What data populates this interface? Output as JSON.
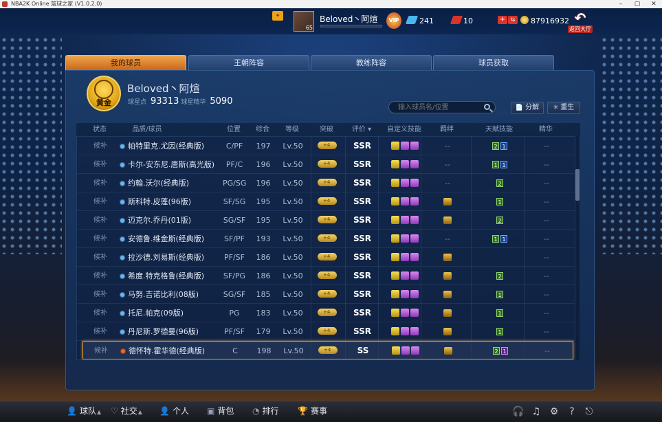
{
  "window": {
    "title": "NBA2K Online 篮球之家 (V1.0.2.0)"
  },
  "topbar": {
    "gift_icon": "gift-box-icon",
    "avatar_level": "65",
    "username": "Beloved丶阿煊",
    "vip_label": "VIP",
    "blue_gems": "241",
    "red_gems": "10",
    "plus_label": "+",
    "exchange_label": "⇆",
    "coins": "87916932",
    "back_label": "返回大厅",
    "back_arrow": "↶"
  },
  "tabs": [
    {
      "label": "我的球员",
      "active": true
    },
    {
      "label": "王朝阵容",
      "active": false
    },
    {
      "label": "教练阵容",
      "active": false
    },
    {
      "label": "球员获取",
      "active": false
    }
  ],
  "profile": {
    "name": "Beloved丶阿煊",
    "tier": "黄金",
    "star_points_label": "球星点",
    "star_points": "93313",
    "essence_label": "球星精华",
    "essence": "5090"
  },
  "search": {
    "placeholder": "输入球员名/位置"
  },
  "tools": {
    "decompose": "分解",
    "decompose_icon": "📄",
    "rebirth": "重生",
    "rebirth_icon": "✳"
  },
  "table": {
    "headers": [
      "状态",
      "品质/球员",
      "位置",
      "综合",
      "等级",
      "突破",
      "评价 ▾",
      "自定义技能",
      "羁绊",
      "天赋技能",
      "精华"
    ],
    "rows": [
      {
        "status": "候补",
        "name": "帕特里克.尤因(经典版)",
        "pos": "C/PF",
        "ovr": "197",
        "lvl": "Lv.50",
        "grade": "SSR",
        "bond": "--",
        "talent": [
          "2",
          "1"
        ],
        "talent_colors": [
          "g",
          "b"
        ],
        "essence": "--",
        "dot": "blue",
        "has_bond_icon": false
      },
      {
        "status": "候补",
        "name": "卡尔-安东尼.唐斯(高光版)",
        "pos": "PF/C",
        "ovr": "196",
        "lvl": "Lv.50",
        "grade": "SSR",
        "bond": "--",
        "talent": [
          "1",
          "1"
        ],
        "talent_colors": [
          "g",
          "b"
        ],
        "essence": "--",
        "dot": "blue",
        "has_bond_icon": false
      },
      {
        "status": "候补",
        "name": "约翰.沃尔(经典版)",
        "pos": "PG/SG",
        "ovr": "196",
        "lvl": "Lv.50",
        "grade": "SSR",
        "bond": "--",
        "talent": [
          "2"
        ],
        "talent_colors": [
          "g"
        ],
        "essence": "--",
        "dot": "blue",
        "has_bond_icon": false
      },
      {
        "status": "候补",
        "name": "斯科特.皮蓬(96版)",
        "pos": "SF/SG",
        "ovr": "195",
        "lvl": "Lv.50",
        "grade": "SSR",
        "bond": "",
        "talent": [
          "1"
        ],
        "talent_colors": [
          "g"
        ],
        "essence": "--",
        "dot": "blue",
        "has_bond_icon": true
      },
      {
        "status": "候补",
        "name": "迈克尔.乔丹(01版)",
        "pos": "SG/SF",
        "ovr": "195",
        "lvl": "Lv.50",
        "grade": "SSR",
        "bond": "",
        "talent": [
          "2"
        ],
        "talent_colors": [
          "g"
        ],
        "essence": "--",
        "dot": "blue",
        "has_bond_icon": true
      },
      {
        "status": "候补",
        "name": "安德鲁.维金斯(经典版)",
        "pos": "SF/PF",
        "ovr": "193",
        "lvl": "Lv.50",
        "grade": "SSR",
        "bond": "--",
        "talent": [
          "1",
          "1"
        ],
        "talent_colors": [
          "g",
          "b"
        ],
        "essence": "--",
        "dot": "blue",
        "has_bond_icon": false
      },
      {
        "status": "候补",
        "name": "拉沙德.刘易斯(经典版)",
        "pos": "PF/SF",
        "ovr": "186",
        "lvl": "Lv.50",
        "grade": "SSR",
        "bond": "",
        "talent": [],
        "talent_colors": [],
        "essence": "--",
        "dot": "blue",
        "has_bond_icon": true
      },
      {
        "status": "候补",
        "name": "希度.特克格鲁(经典版)",
        "pos": "SF/PG",
        "ovr": "186",
        "lvl": "Lv.50",
        "grade": "SSR",
        "bond": "",
        "talent": [
          "2"
        ],
        "talent_colors": [
          "g"
        ],
        "essence": "--",
        "dot": "blue",
        "has_bond_icon": true
      },
      {
        "status": "候补",
        "name": "马努.吉诺比利(08版)",
        "pos": "SG/SF",
        "ovr": "185",
        "lvl": "Lv.50",
        "grade": "SSR",
        "bond": "",
        "talent": [
          "1"
        ],
        "talent_colors": [
          "g"
        ],
        "essence": "--",
        "dot": "blue",
        "has_bond_icon": true
      },
      {
        "status": "候补",
        "name": "托尼.帕克(09版)",
        "pos": "PG",
        "ovr": "183",
        "lvl": "Lv.50",
        "grade": "SSR",
        "bond": "",
        "talent": [
          "1"
        ],
        "talent_colors": [
          "g"
        ],
        "essence": "--",
        "dot": "blue",
        "has_bond_icon": true
      },
      {
        "status": "候补",
        "name": "丹尼斯.罗德曼(96版)",
        "pos": "PF/SF",
        "ovr": "179",
        "lvl": "Lv.50",
        "grade": "SSR",
        "bond": "",
        "talent": [
          "1"
        ],
        "talent_colors": [
          "g"
        ],
        "essence": "--",
        "dot": "blue",
        "has_bond_icon": true
      },
      {
        "status": "候补",
        "name": "德怀特.霍华德(经典版)",
        "pos": "C",
        "ovr": "198",
        "lvl": "Lv.50",
        "grade": "SS",
        "bond": "",
        "talent": [
          "2",
          "1"
        ],
        "talent_colors": [
          "g",
          "pu"
        ],
        "essence": "--",
        "dot": "orange",
        "has_bond_icon": true,
        "selected": true
      }
    ]
  },
  "scroll": {
    "position": 0.17
  },
  "bottom_nav": [
    {
      "label": "球队",
      "icon": "person-icon",
      "glyph": "👤",
      "caret": "▲"
    },
    {
      "label": "社交",
      "icon": "heart-icon",
      "glyph": "♡",
      "caret": "▲"
    },
    {
      "label": "个人",
      "icon": "profile-icon",
      "glyph": "👤",
      "caret": ""
    },
    {
      "label": "背包",
      "icon": "bag-icon",
      "glyph": "▣",
      "caret": ""
    },
    {
      "label": "排行",
      "icon": "rank-icon",
      "glyph": "◔",
      "caret": ""
    },
    {
      "label": "赛事",
      "icon": "trophy-icon",
      "glyph": "🏆",
      "caret": ""
    }
  ],
  "system_icons": [
    {
      "name": "headset-icon",
      "glyph": "🎧"
    },
    {
      "name": "music-icon",
      "glyph": "♫"
    },
    {
      "name": "gear-icon",
      "glyph": "⚙"
    },
    {
      "name": "help-icon",
      "glyph": "?"
    },
    {
      "name": "exit-icon",
      "glyph": "⎋"
    }
  ],
  "colors": {
    "active_tab": "#e8902e",
    "selected_row": "#e79a34",
    "grade": "#ffffff"
  }
}
